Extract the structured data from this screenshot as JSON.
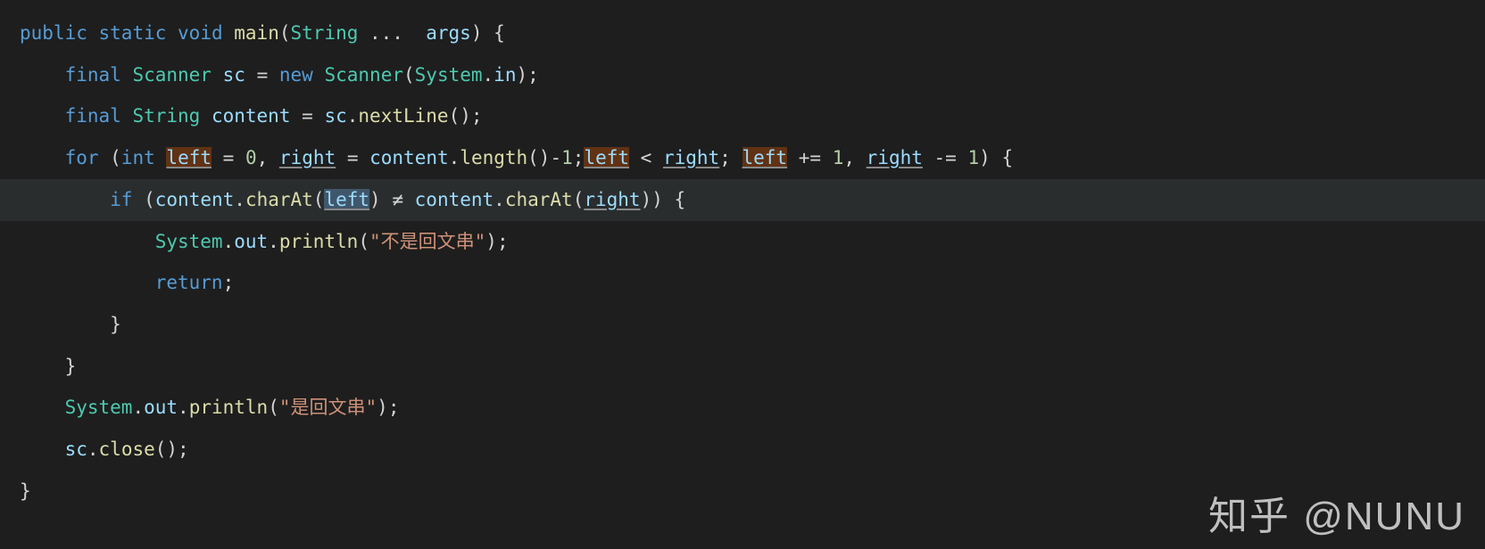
{
  "watermark": "知乎 @NUNU",
  "tokens": {
    "kw_public": "public",
    "kw_static": "static",
    "kw_void": "void",
    "kw_final": "final",
    "kw_new": "new",
    "kw_for": "for",
    "kw_int": "int",
    "kw_if": "if",
    "kw_return": "return",
    "fn_main": "main",
    "fn_nextLine": "nextLine",
    "fn_length": "length",
    "fn_charAt": "charAt",
    "fn_println": "println",
    "fn_close": "close",
    "type_String": "String",
    "type_Scanner": "Scanner",
    "type_System": "System",
    "var_args": "args",
    "var_sc": "sc",
    "var_content": "content",
    "var_left": "left",
    "var_right": "right",
    "var_in": "in",
    "var_out": "out",
    "num_0": "0",
    "num_1a": "1",
    "num_1b": "1",
    "num_1c": "1",
    "str_not_palindrome": "\"不是回文串\"",
    "str_is_palindrome": "\"是回文串\"",
    "op_neq": "≠",
    "ellipsis": "..."
  }
}
